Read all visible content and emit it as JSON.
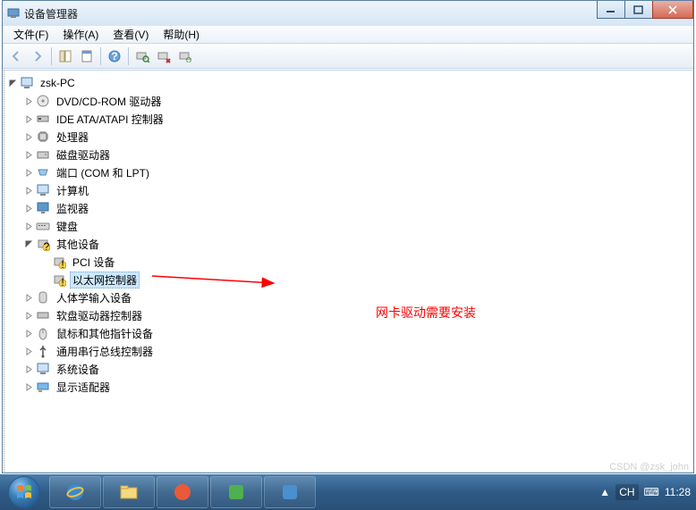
{
  "window": {
    "title": "设备管理器"
  },
  "menu": {
    "file": "文件(F)",
    "action": "操作(A)",
    "view": "查看(V)",
    "help": "帮助(H)"
  },
  "tree": {
    "root": "zsk-PC",
    "dvd": "DVD/CD-ROM 驱动器",
    "ide": "IDE ATA/ATAPI 控制器",
    "cpu": "处理器",
    "disk": "磁盘驱动器",
    "ports": "端口 (COM 和 LPT)",
    "computer": "计算机",
    "monitor": "监视器",
    "keyboard": "键盘",
    "other": "其他设备",
    "other_pci": "PCI 设备",
    "other_eth": "以太网控制器",
    "hid": "人体学输入设备",
    "floppy": "软盘驱动器控制器",
    "mouse": "鼠标和其他指针设备",
    "usb": "通用串行总线控制器",
    "system": "系统设备",
    "display": "显示适配器"
  },
  "annotation": {
    "text": "网卡驱动需要安装"
  },
  "watermark": "CSDN @zsk_john",
  "taskbar": {
    "lang": "CH",
    "ime": "⌨",
    "time": "11:28"
  }
}
